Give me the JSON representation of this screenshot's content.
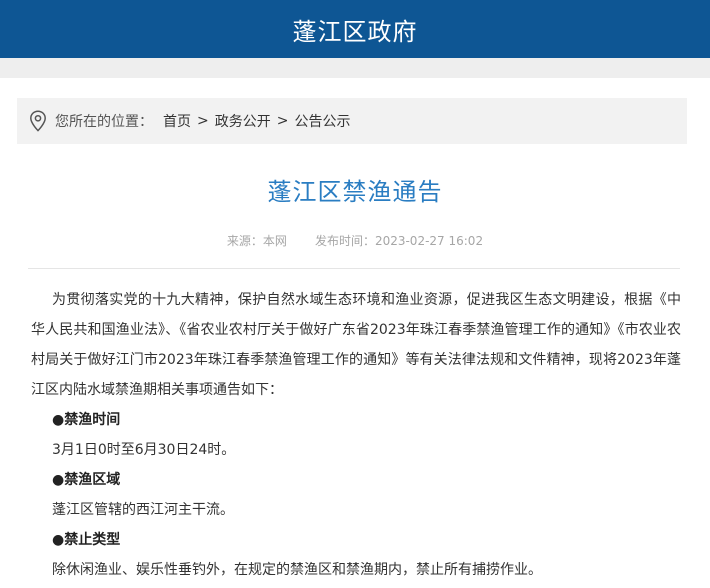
{
  "header": {
    "site_title": "蓬江区政府"
  },
  "breadcrumb": {
    "prefix": "您所在的位置：",
    "items": [
      {
        "label": "首页"
      },
      {
        "label": "政务公开"
      },
      {
        "label": "公告公示"
      }
    ],
    "separator": ">"
  },
  "article": {
    "title": "蓬江区禁渔通告",
    "source_label": "来源：本网",
    "publish_label": "发布时间：2023-02-27 16:02",
    "intro": "为贯彻落实党的十九大精神，保护自然水域生态环境和渔业资源，促进我区生态文明建设，根据《中华人民共和国渔业法》、《省农业农村厅关于做好广东省2023年珠江春季禁渔管理工作的通知》《市农业农村局关于做好江门市2023年珠江春季禁渔管理工作的通知》等有关法律法规和文件精神，现将2023年蓬江区内陆水域禁渔期相关事项通告如下：",
    "sections": [
      {
        "heading": "●禁渔时间",
        "text": "3月1日0时至6月30日24时。"
      },
      {
        "heading": "●禁渔区域",
        "text": "蓬江区管辖的西江河主干流。"
      },
      {
        "heading": "●禁止类型",
        "text": "除休闲渔业、娱乐性垂钓外，在规定的禁渔区和禁渔期内，禁止所有捕捞作业。"
      }
    ]
  },
  "colors": {
    "header_bg": "#0e5694",
    "title": "#2a7dc2",
    "meta": "#a6a6a6",
    "breadcrumb_bg": "#f2f2f2"
  },
  "icons": {
    "breadcrumb_icon": "location-pin-icon"
  }
}
